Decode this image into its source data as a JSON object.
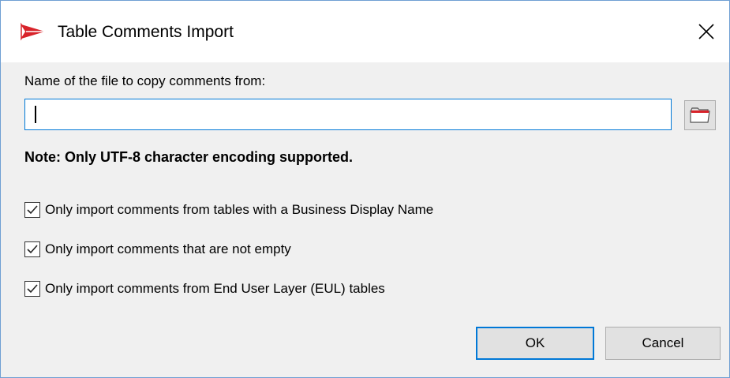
{
  "window": {
    "title": "Table Comments Import"
  },
  "file": {
    "label": "Name of the file to copy comments from:",
    "value": "",
    "placeholder": ""
  },
  "note": "Note: Only UTF-8 character encoding supported.",
  "options": [
    {
      "label": "Only import comments from tables with a Business Display Name",
      "checked": true
    },
    {
      "label": "Only import comments that are not empty",
      "checked": true
    },
    {
      "label": "Only import comments from End User Layer (EUL) tables",
      "checked": true
    }
  ],
  "buttons": {
    "ok": "OK",
    "cancel": "Cancel"
  },
  "icons": {
    "app": "app-logo-icon",
    "close": "close-icon",
    "browse": "folder-icon",
    "check": "checkmark-icon"
  },
  "colors": {
    "accent": "#0078d7",
    "logo_red": "#d8232a"
  }
}
